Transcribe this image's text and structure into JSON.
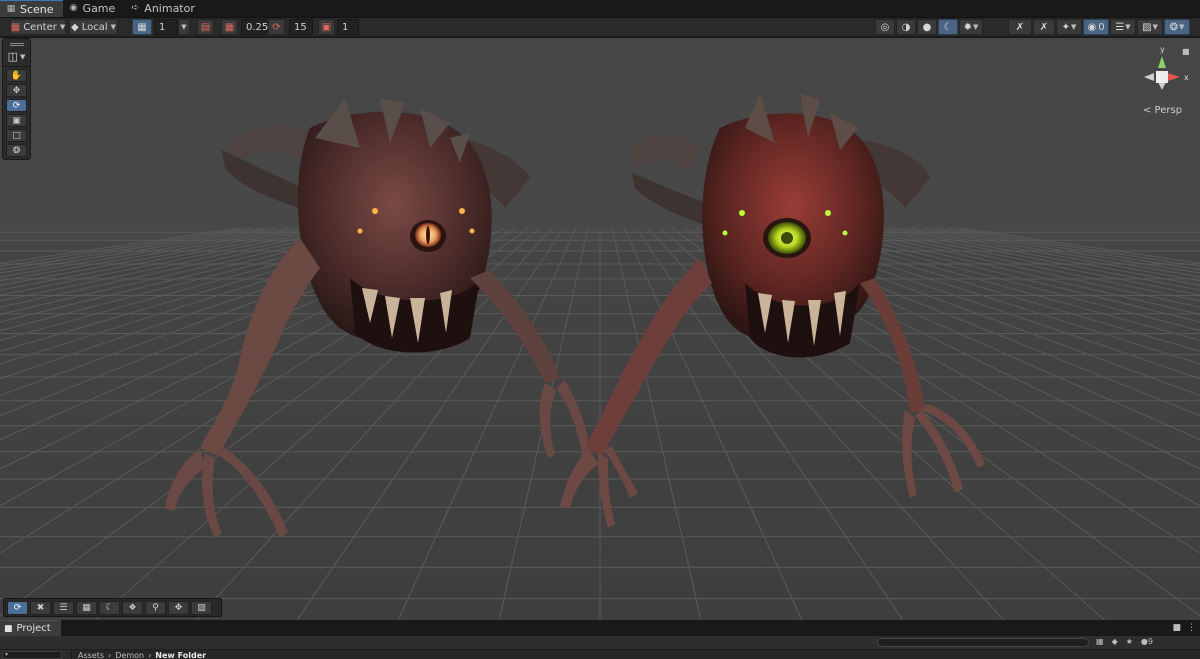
{
  "tabs": [
    {
      "label": "Scene",
      "icon": "scene-icon"
    },
    {
      "label": "Game",
      "icon": "game-controller-icon"
    },
    {
      "label": "Animator",
      "icon": "animator-icon"
    }
  ],
  "toolbar": {
    "pivot_label": "Center",
    "space_label": "Local",
    "grid_size": "1",
    "snap_move": "0.25",
    "snap_rotate": "15",
    "snap_scale": "1",
    "visibility_count": "0"
  },
  "gizmo": {
    "y_label": "y",
    "x_label": "x",
    "projection_label": "< Persp"
  },
  "tools": [
    "view-hand",
    "move",
    "rotate",
    "scale",
    "rect",
    "transform"
  ],
  "overlay_tools": [
    "rotate",
    "scale",
    "align",
    "snap",
    "lighting",
    "fx",
    "search",
    "move",
    "camera"
  ],
  "project": {
    "tab_label": "Project",
    "search_placeholder": "",
    "breadcrumb": [
      "Assets",
      "Demon",
      "New Folder"
    ],
    "asset_count": "9"
  },
  "colors": {
    "accent": "#3a79bb",
    "active_button": "#4a6483",
    "viewport": "#464646",
    "panel": "#2a2a2a"
  }
}
